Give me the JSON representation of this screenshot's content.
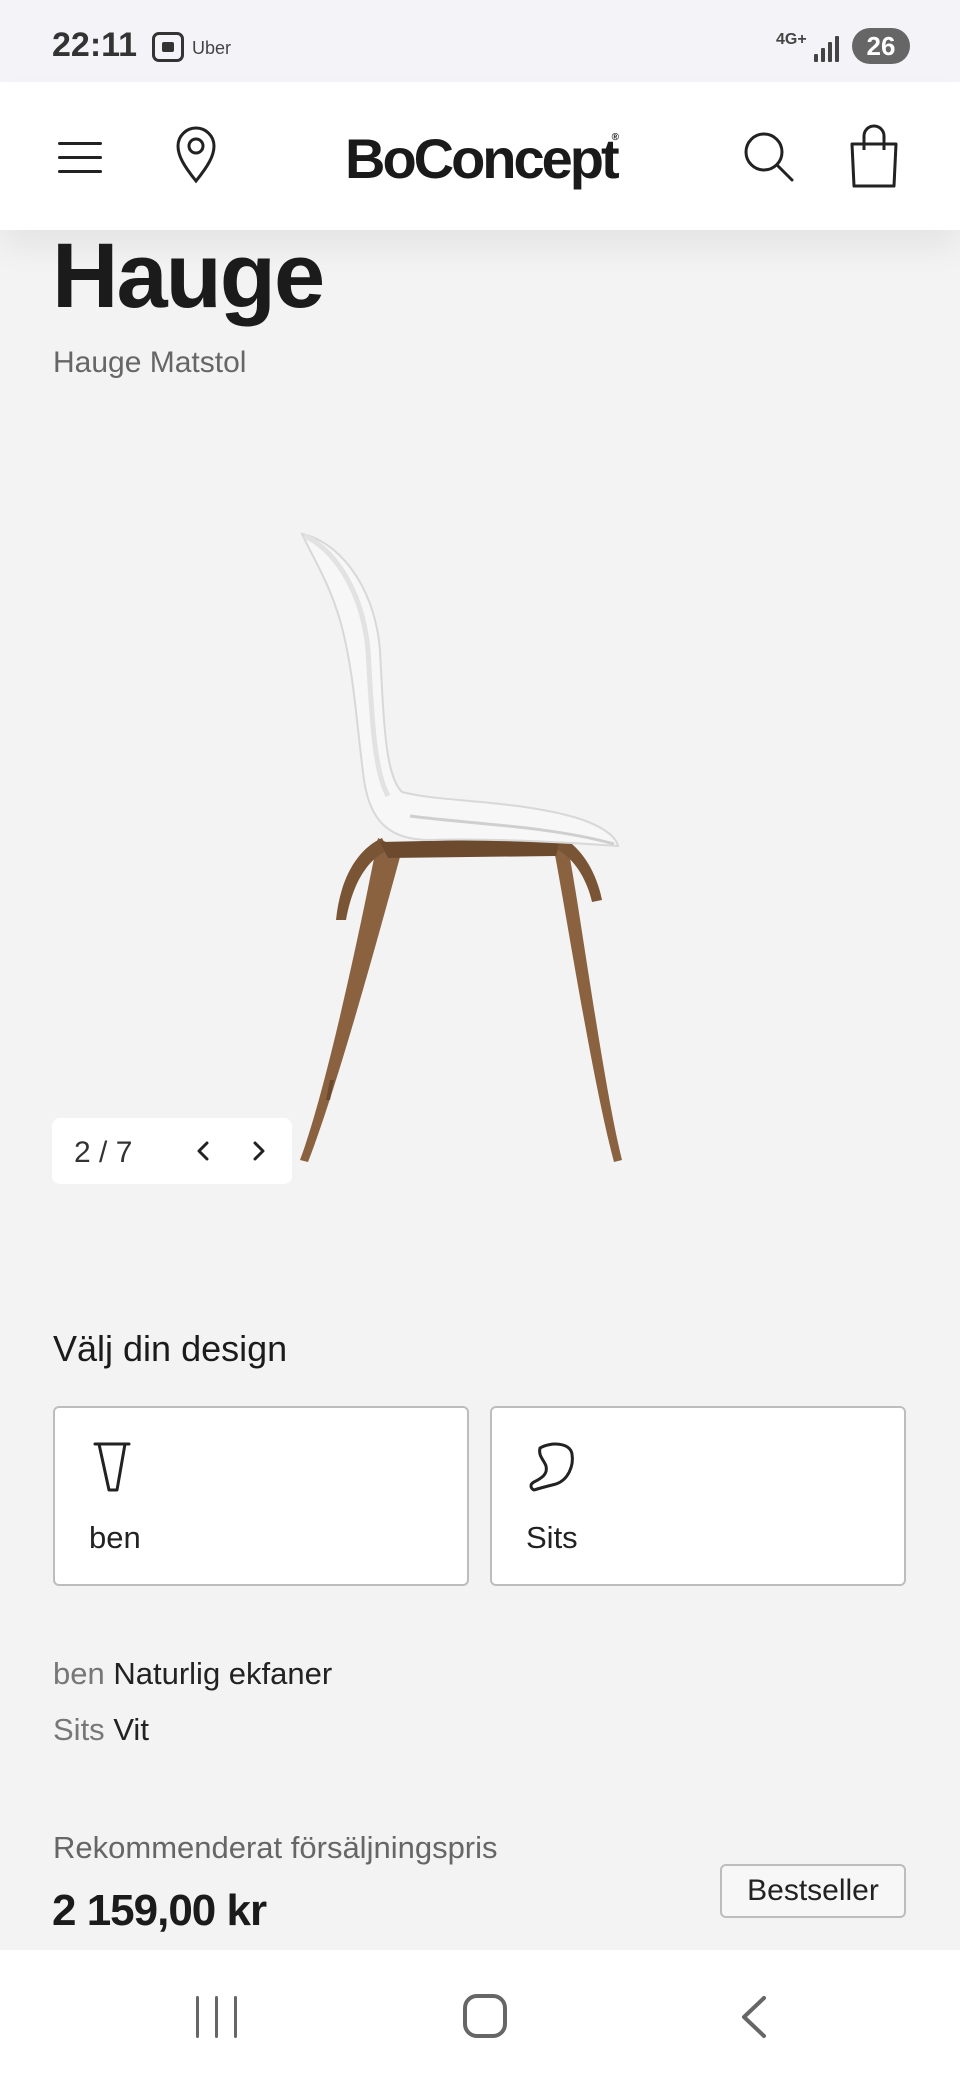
{
  "status_bar": {
    "time": "22:11",
    "app_label": "Uber",
    "network": "4G+",
    "battery": "26"
  },
  "header": {
    "logo": "BoConcept",
    "logo_mark": "®",
    "icons": [
      "menu-icon",
      "location-icon",
      "search-icon",
      "shopping-bag-icon"
    ]
  },
  "product": {
    "name": "Hauge",
    "subtitle": "Hauge Matstol"
  },
  "gallery": {
    "counter": "2 / 7",
    "current": 2,
    "total": 7
  },
  "design": {
    "heading": "Välj din design",
    "options": [
      {
        "label": "ben",
        "icon": "chair-leg-icon"
      },
      {
        "label": "Sits",
        "icon": "seat-shell-icon"
      }
    ],
    "selections": [
      {
        "key": "ben",
        "value": "Naturlig ekfaner"
      },
      {
        "key": "Sits",
        "value": "Vit"
      }
    ]
  },
  "price": {
    "label": "Rekommenderat försäljningspris",
    "value": "2 159,00 kr",
    "badge": "Bestseller"
  },
  "colors": {
    "background": "#f3f3f4",
    "text": "#1b1b1b",
    "muted": "#666666",
    "card_border": "#bdbdbd",
    "wood": "#8a6240",
    "shell": "#f5f5f5"
  }
}
